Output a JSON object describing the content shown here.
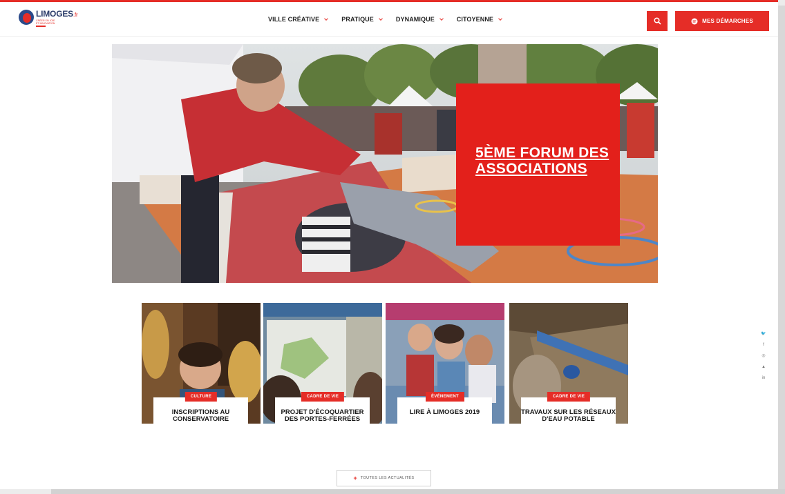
{
  "header": {
    "logo_text": "LIMOGES",
    "logo_suffix": ".fr",
    "logo_sub1": "Créer en joie",
    "logo_sub2": "et innovation",
    "nav": [
      {
        "label": "VILLE CRÉATIVE"
      },
      {
        "label": "PRATIQUE"
      },
      {
        "label": "DYNAMIQUE"
      },
      {
        "label": "CITOYENNE"
      }
    ],
    "demarches_label": "MES DÉMARCHES"
  },
  "hero": {
    "title": "5ÈME FORUM DES ASSOCIATIONS"
  },
  "cards": [
    {
      "category": "CULTURE",
      "title": "INSCRIPTIONS AU CONSERVATOIRE"
    },
    {
      "category": "CADRE DE VIE",
      "title": "PROJET D'ÉCOQUARTIER DES PORTES-FERRÉES"
    },
    {
      "category": "ÉVÉNEMENT",
      "title": "LIRE À LIMOGES 2019"
    },
    {
      "category": "CADRE DE VIE",
      "title": "TRAVAUX SUR LES RÉSEAUX D'EAU POTABLE"
    }
  ],
  "all_news_label": "TOUTES LES ACTUALITÉS",
  "social": [
    "twitter-icon",
    "facebook-icon",
    "instagram-icon",
    "snapchat-icon",
    "linkedin-icon"
  ],
  "social_glyphs": [
    "🐦",
    "f",
    "◎",
    "▲",
    "in"
  ],
  "colors": {
    "accent": "#e52d27",
    "navy": "#2b3c6a"
  }
}
